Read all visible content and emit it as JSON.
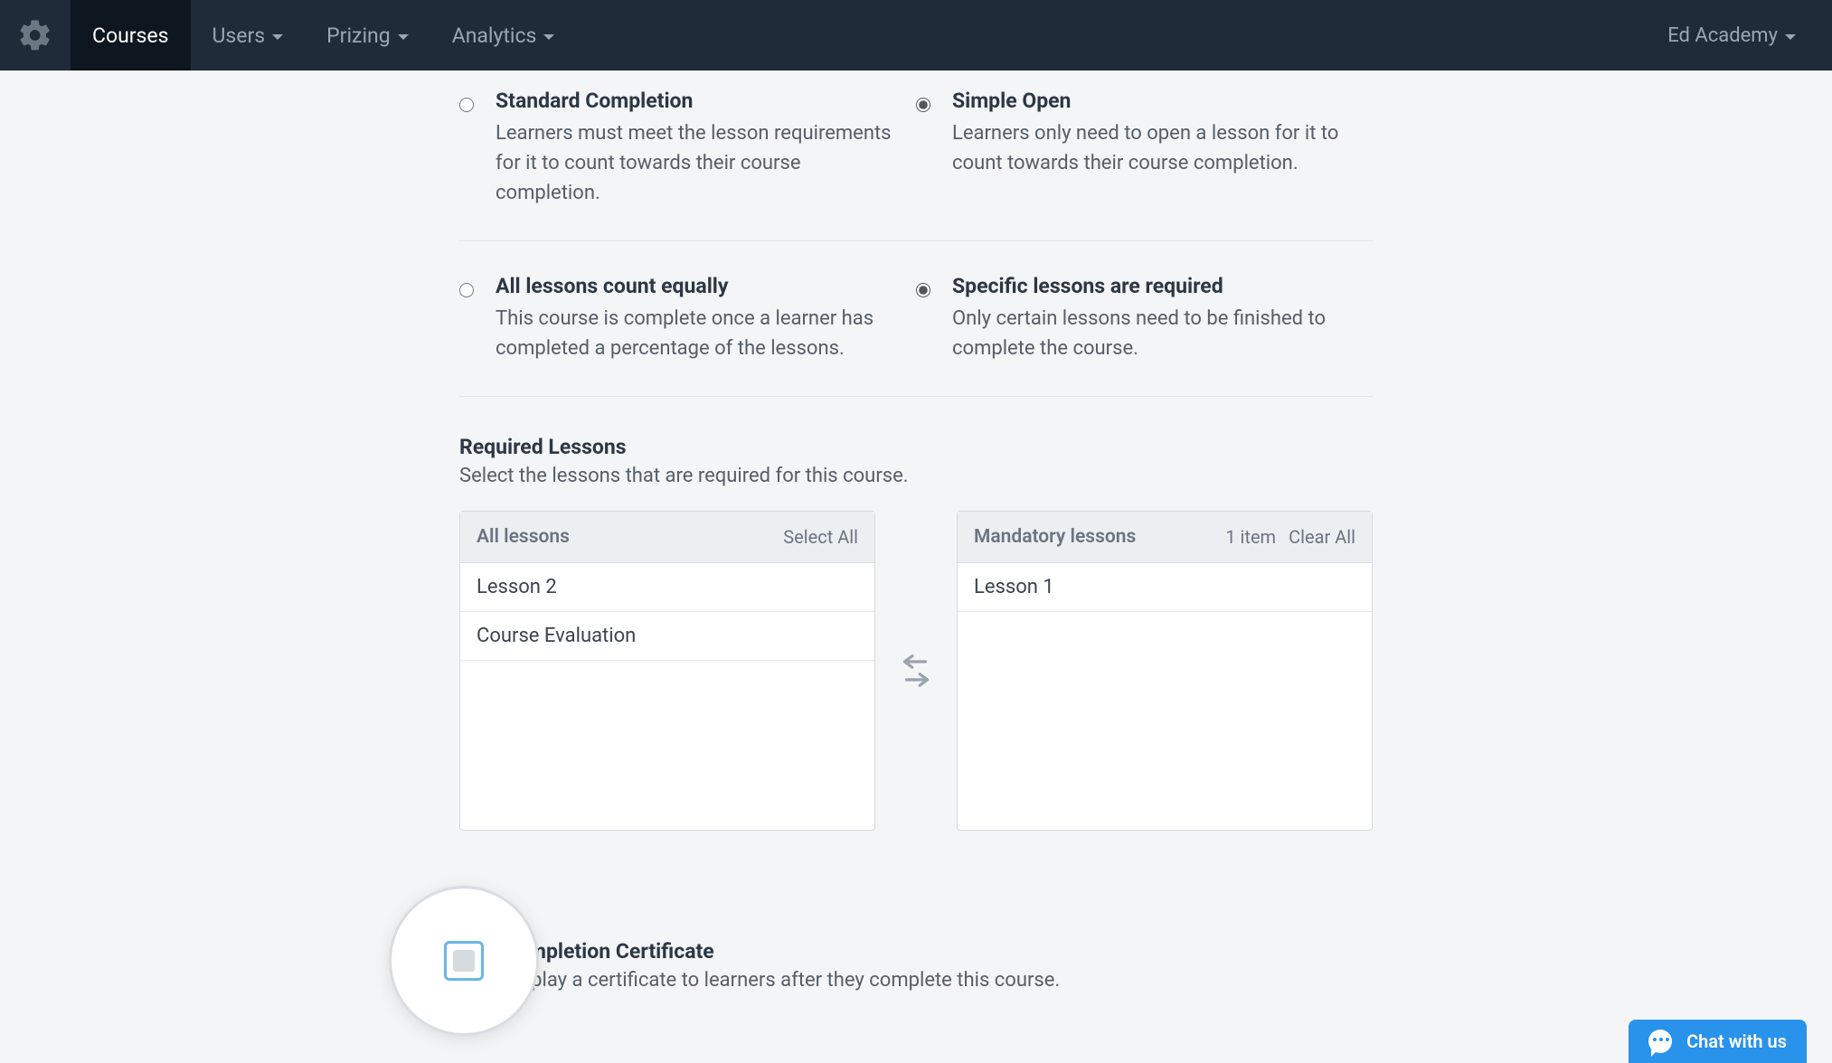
{
  "nav": {
    "items": [
      {
        "label": "Courses",
        "active": true,
        "caret": false
      },
      {
        "label": "Users",
        "active": false,
        "caret": true
      },
      {
        "label": "Prizing",
        "active": false,
        "caret": true
      },
      {
        "label": "Analytics",
        "active": false,
        "caret": true
      }
    ],
    "account": "Ed Academy"
  },
  "completion_mode": {
    "options": [
      {
        "id": "standard",
        "title": "Standard Completion",
        "desc": "Learners must meet the lesson requirements for it to count towards their course completion.",
        "selected": false
      },
      {
        "id": "simple",
        "title": "Simple Open",
        "desc": "Learners only need to open a lesson for it to count towards their course completion.",
        "selected": true
      }
    ]
  },
  "lesson_weight": {
    "options": [
      {
        "id": "equal",
        "title": "All lessons count equally",
        "desc": "This course is complete once a learner has completed a percentage of the lessons.",
        "selected": false
      },
      {
        "id": "specific",
        "title": "Specific lessons are required",
        "desc": "Only certain lessons need to be finished to complete the course.",
        "selected": true
      }
    ]
  },
  "required_lessons": {
    "heading": "Required Lessons",
    "subheading": "Select the lessons that are required for this course.",
    "all": {
      "title": "All lessons",
      "action": "Select All",
      "items": [
        "Lesson 2",
        "Course Evaluation"
      ]
    },
    "mandatory": {
      "title": "Mandatory lessons",
      "count_label": "1 item",
      "action": "Clear All",
      "items": [
        "Lesson 1"
      ]
    }
  },
  "certificate": {
    "title": "Completion Certificate",
    "desc": "Display a certificate to learners after they complete this course.",
    "checked": false
  },
  "chat": {
    "label": "Chat with us"
  }
}
